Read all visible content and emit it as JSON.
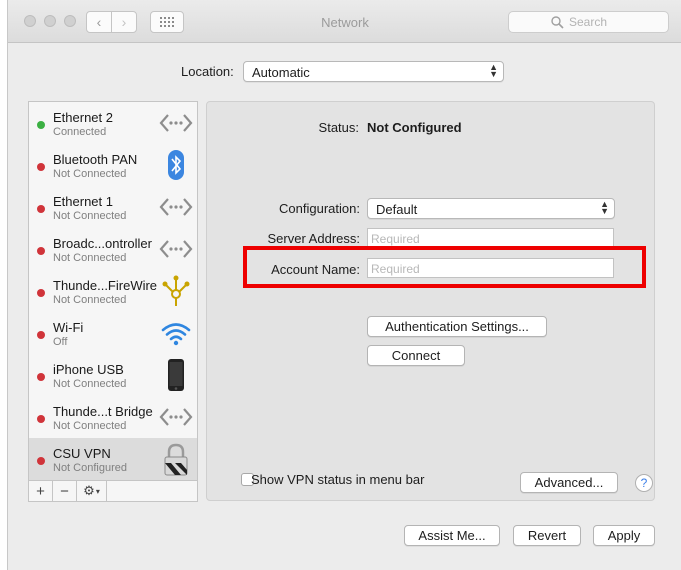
{
  "window": {
    "title": "Network"
  },
  "search": {
    "placeholder": "Search"
  },
  "location": {
    "label": "Location:",
    "value": "Automatic"
  },
  "services": [
    {
      "name": "Ethernet 2",
      "status": "Connected",
      "color": "#3cb043",
      "icon": "ethernet-icon"
    },
    {
      "name": "Bluetooth PAN",
      "status": "Not Connected",
      "color": "#d0343a",
      "icon": "bluetooth-icon"
    },
    {
      "name": "Ethernet 1",
      "status": "Not Connected",
      "color": "#d0343a",
      "icon": "ethernet-icon"
    },
    {
      "name": "Broadc...ontroller",
      "status": "Not Connected",
      "color": "#d0343a",
      "icon": "ethernet-icon"
    },
    {
      "name": "Thunde...FireWire",
      "status": "Not Connected",
      "color": "#d0343a",
      "icon": "firewire-icon"
    },
    {
      "name": "Wi-Fi",
      "status": "Off",
      "color": "#d0343a",
      "icon": "wifi-icon"
    },
    {
      "name": "iPhone USB",
      "status": "Not Connected",
      "color": "#d0343a",
      "icon": "iphone-icon"
    },
    {
      "name": "Thunde...t Bridge",
      "status": "Not Connected",
      "color": "#d0343a",
      "icon": "ethernet-icon"
    },
    {
      "name": "CSU VPN",
      "status": "Not Configured",
      "color": "#d0343a",
      "icon": "vpn-lock-icon"
    }
  ],
  "sidebar_tools": {
    "add": "+",
    "remove": "−",
    "gear": "⚙"
  },
  "detail": {
    "status_label": "Status:",
    "status_value": "Not Configured",
    "configuration_label": "Configuration:",
    "configuration_value": "Default",
    "server_label": "Server Address:",
    "server_placeholder": "Required",
    "account_label": "Account Name:",
    "account_placeholder": "Required",
    "auth_button": "Authentication Settings...",
    "connect_button": "Connect",
    "show_vpn_label": "Show VPN status in menu bar",
    "advanced_button": "Advanced...",
    "help": "?"
  },
  "footer": {
    "assist": "Assist Me...",
    "revert": "Revert",
    "apply": "Apply"
  }
}
